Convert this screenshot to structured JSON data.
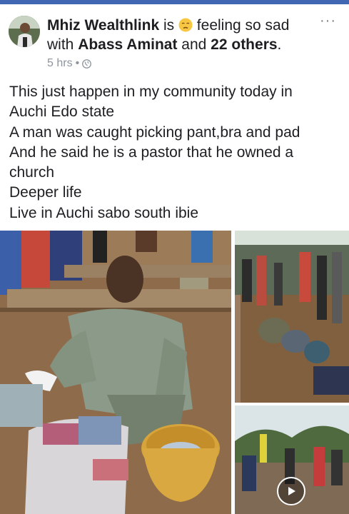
{
  "post": {
    "author": "Mhiz Wealthlink",
    "is_text": " is ",
    "feeling_text": " feeling so sad",
    "with_text": "with ",
    "tagged_name": "Abass Aminat",
    "and_text": " and ",
    "others_text": "22 others",
    "period": ".",
    "timestamp": "5 hrs",
    "separator": "•",
    "lines": [
      "This just happen in my community today in",
      "Auchi Edo state",
      "A man was caught picking pant,bra and pad",
      "And he said he is a pastor that he owned a",
      "church",
      "Deeper life",
      "Live in Auchi sabo south ibie"
    ]
  },
  "icons": {
    "more": "more-options-icon",
    "privacy": "globe-icon",
    "feeling": "sad-face-emoji-icon",
    "video": "play-icon"
  },
  "colors": {
    "accent": "#4267b2",
    "text": "#1c1e21",
    "muted": "#8d949e"
  }
}
